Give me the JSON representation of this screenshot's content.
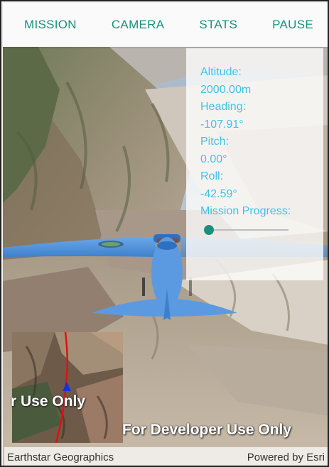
{
  "app_bar": {
    "mission_label": "MISSION",
    "camera_label": "CAMERA",
    "stats_label": "STATS",
    "pause_label": "PAUSE",
    "accent_color": "#1a8f7e"
  },
  "stats": {
    "altitude_label": "Altitude:",
    "altitude_value": "2000.00m",
    "heading_label": "Heading:",
    "heading_value": "-107.91°",
    "pitch_label": "Pitch:",
    "pitch_value": "0.00°",
    "roll_label": "Roll:",
    "roll_value": "-42.59°",
    "progress_label": "Mission Progress:",
    "progress_fraction": 0.0,
    "text_color": "#3fc3e8"
  },
  "map": {
    "watermark_minimap": "r Use Only",
    "watermark_scene": "For Developer Use Only",
    "attribution_left": "Earthstar Geographics",
    "attribution_right": "Powered by Esri",
    "route_color": "#e01010",
    "aircraft_marker": "triangle-marker-icon"
  }
}
